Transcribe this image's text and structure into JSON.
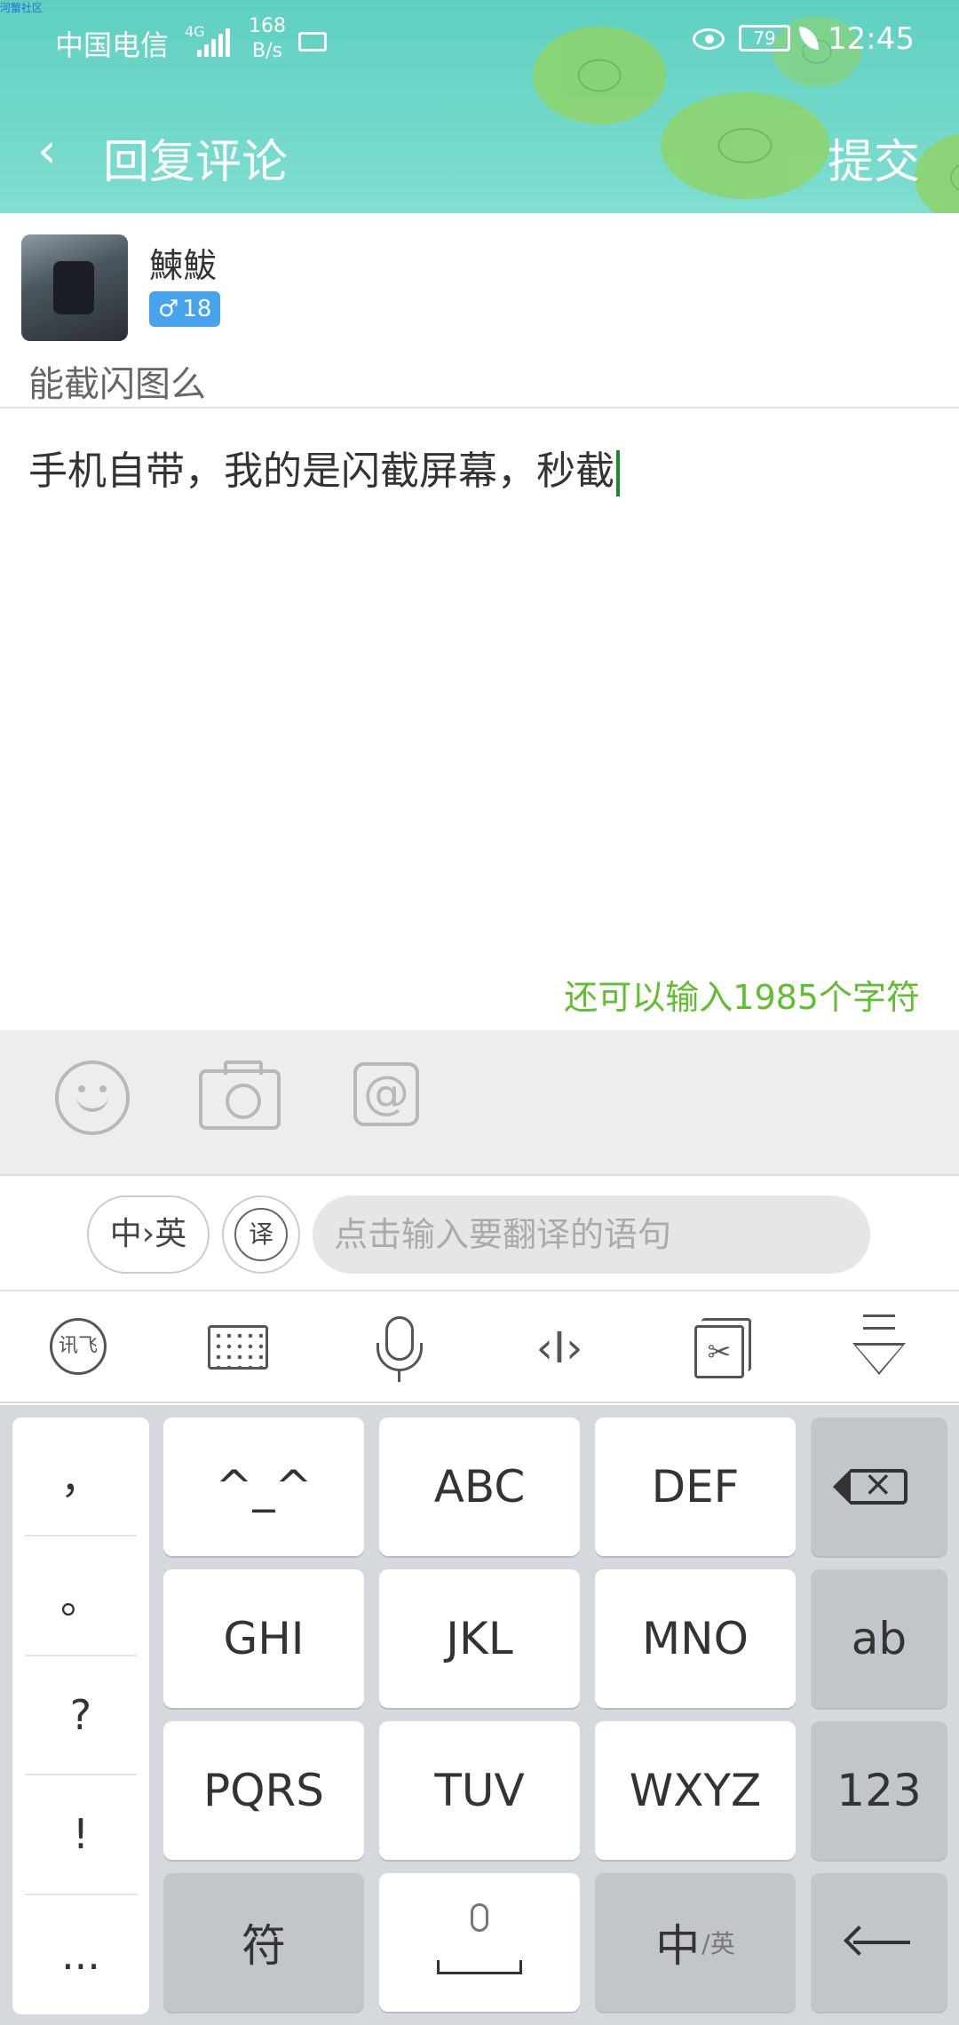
{
  "app": {
    "watermark": "河蟹社区"
  },
  "status_bar": {
    "carrier": "中国电信",
    "network_type": "4G",
    "speed_value": "168",
    "speed_unit": "B/s",
    "battery": "79",
    "time": "12:45"
  },
  "header": {
    "title": "回复评论",
    "back_icon": "chevron-left-icon",
    "submit_label": "提交"
  },
  "original_comment": {
    "username": "鰊鮁",
    "gender_symbol": "♂",
    "age": "18",
    "text": "能截闪图么"
  },
  "reply": {
    "text": "手机自带，我的是闪截屏幕，秒截",
    "remaining_chars": "还可以输入1985个字符"
  },
  "attach_bar": {
    "icons": [
      "smile-icon",
      "camera-icon",
      "at-icon"
    ],
    "at_symbol": "@"
  },
  "translate": {
    "lang_toggle": "中›英",
    "translate_btn": "译",
    "placeholder": "点击输入要翻译的语句"
  },
  "keyboard_toolbar": {
    "xunfei_label": "讯飞",
    "cursor_symbol": "‹I›",
    "clipboard_symbol": "✂"
  },
  "keyboard": {
    "punctuation": [
      "，",
      "。",
      "?",
      "!",
      "..."
    ],
    "rows": [
      [
        "^_^",
        "ABC",
        "DEF"
      ],
      [
        "GHI",
        "JKL",
        "MNO"
      ],
      [
        "PQRS",
        "TUV",
        "WXYZ"
      ]
    ],
    "right_keys": [
      "ab",
      "123"
    ],
    "symbol_key": "符",
    "lang_key_main": "中",
    "lang_key_sub": "/英"
  },
  "colors": {
    "header_teal": "#6fd7c8",
    "counter_green": "#5fbf2e",
    "badge_blue": "#47a3ee",
    "cursor_green": "#1a8b2a"
  }
}
